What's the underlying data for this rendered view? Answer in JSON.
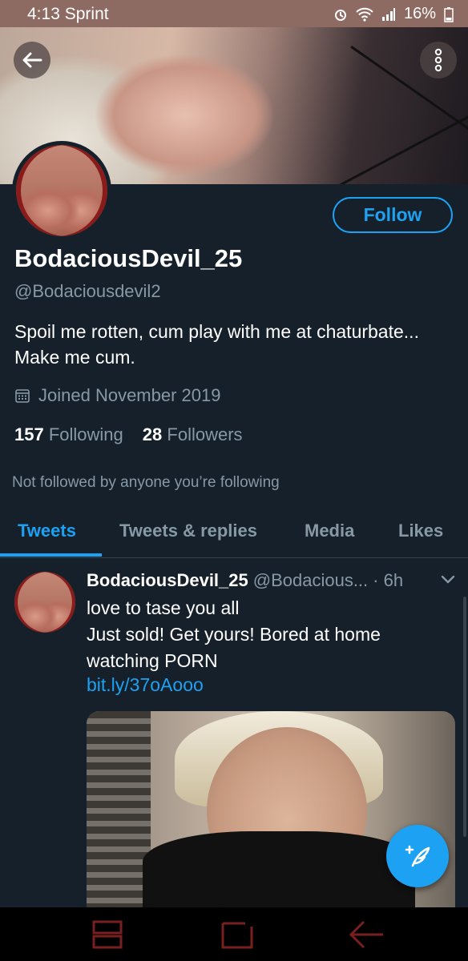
{
  "status_bar": {
    "time": "4:13",
    "carrier": "Sprint",
    "battery": "16%"
  },
  "profile": {
    "display_name": "BodaciousDevil_25",
    "handle": "@Bodaciousdevil2",
    "bio_line1": "Spoil me rotten, cum play with me at chaturbate...",
    "bio_line2": "Make me cum.",
    "joined": "Joined November 2019",
    "following_count": "157",
    "following_label": "Following",
    "followers_count": "28",
    "followers_label": "Followers",
    "not_followed": "Not followed by anyone you’re following",
    "follow_label": "Follow"
  },
  "tabs": [
    {
      "label": "Tweets",
      "active": true
    },
    {
      "label": "Tweets & replies",
      "active": false
    },
    {
      "label": "Media",
      "active": false
    },
    {
      "label": "Likes",
      "active": false
    }
  ],
  "tweet": {
    "name": "BodaciousDevil_25",
    "handle": "@Bodacious...",
    "time": "· 6h",
    "line1": "love to tase you all",
    "line2": "Just sold! Get yours! Bored at home",
    "line3": "watching PORN",
    "link": "bit.ly/37oAooo"
  },
  "colors": {
    "accent": "#1da1f2",
    "background": "#15202b",
    "secondary_text": "#8899a6"
  },
  "icons": [
    "back-arrow-icon",
    "more-vertical-icon",
    "calendar-icon",
    "chevron-down-icon",
    "compose-tweet-icon",
    "recent-apps-icon",
    "home-icon",
    "nav-back-icon",
    "alarm-icon",
    "wifi-icon",
    "signal-icon",
    "battery-icon"
  ]
}
